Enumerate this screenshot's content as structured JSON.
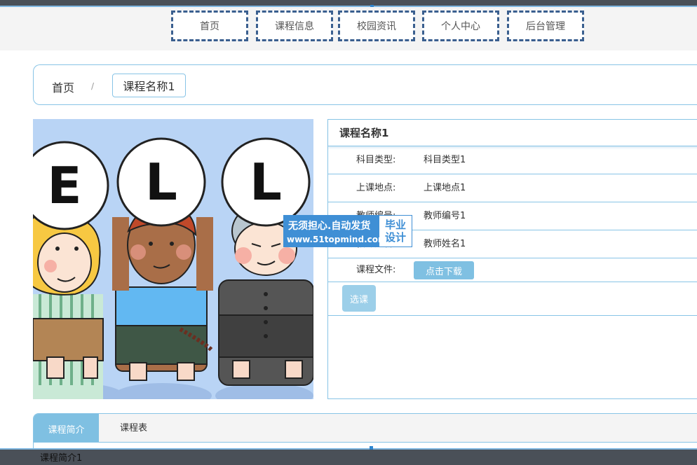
{
  "nav": {
    "items": [
      {
        "label": "首页"
      },
      {
        "label": "课程信息"
      },
      {
        "label": "校园资讯"
      },
      {
        "label": "个人中心"
      },
      {
        "label": "后台管理"
      }
    ]
  },
  "breadcrumb": {
    "home": "首页",
    "separator": "/",
    "current": "课程名称1"
  },
  "image": {
    "letters": [
      "E",
      "L",
      "L"
    ]
  },
  "detail": {
    "title": "课程名称1",
    "rows": [
      {
        "label": "科目类型:",
        "value": "科目类型1"
      },
      {
        "label": "上课地点:",
        "value": "上课地点1"
      },
      {
        "label": "教师编号:",
        "value": "教师编号1"
      },
      {
        "label": "教师姓名:",
        "value": "教师姓名1"
      }
    ],
    "file_label": "课程文件:",
    "download_label": "点击下载",
    "select_label": "选课"
  },
  "watermark": {
    "line1": "无须担心.自动发货",
    "line2": "www.51topmind.com",
    "badge1": "毕业",
    "badge2": "设计"
  },
  "tabs": {
    "items": [
      {
        "label": "课程简介"
      },
      {
        "label": "课程表"
      }
    ],
    "content": "课程简介1"
  }
}
